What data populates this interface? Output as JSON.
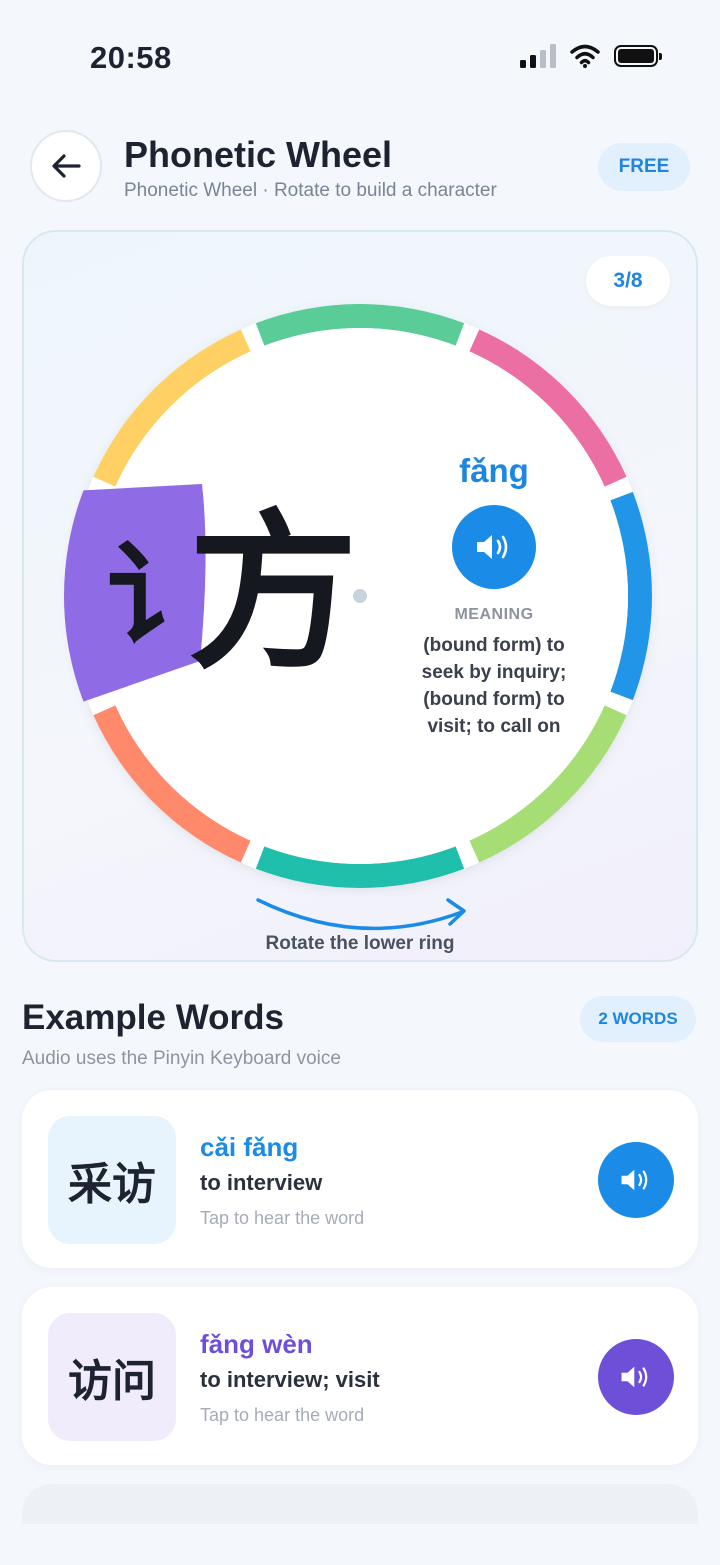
{
  "status": {
    "time": "20:58"
  },
  "header": {
    "title": "Phonetic Wheel",
    "subtitle": "Phonetic Wheel · Rotate to build a character",
    "badge": "FREE"
  },
  "wheel_card": {
    "progress": "3/8",
    "radical": "讠",
    "component": "方",
    "pinyin": "fǎng",
    "meaning_label": "MEANING",
    "meaning": "(bound form) to seek by inquiry; (bound form) to visit; to call on",
    "rotate_hint": "Rotate the lower ring",
    "segment_colors": [
      "#59cc98",
      "#ec6fa4",
      "#2196e8",
      "#a6dd74",
      "#1fbfac",
      "#ff8a6b",
      "#8f6ce5",
      "#ffd064"
    ]
  },
  "examples": {
    "title": "Example Words",
    "subtitle": "Audio uses the Pinyin Keyboard voice",
    "count_badge": "2 WORDS",
    "items": [
      {
        "hanzi": "采访",
        "pinyin": "cǎi fǎng",
        "meaning": "to interview",
        "hint": "Tap to hear the word",
        "accent": "#1a8be6",
        "tile_bg": "#e8f4fd"
      },
      {
        "hanzi": "访问",
        "pinyin": "fǎng wèn",
        "meaning": "to interview; visit",
        "hint": "Tap to hear the word",
        "accent": "#6e4fd8",
        "tile_bg": "#f1ecfb"
      }
    ]
  }
}
